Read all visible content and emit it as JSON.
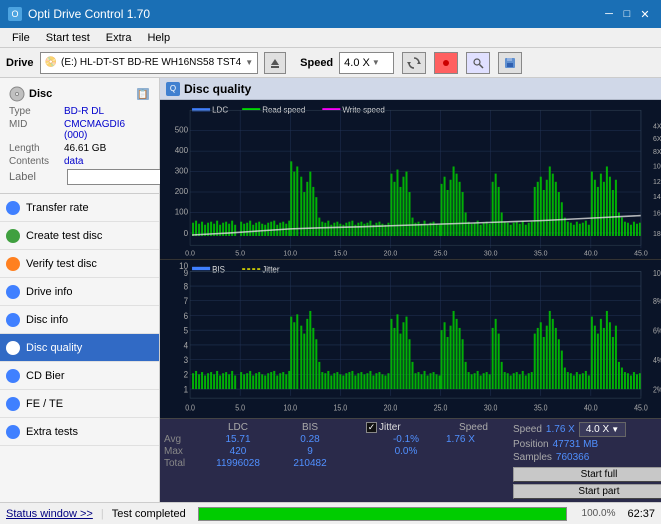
{
  "titleBar": {
    "title": "Opti Drive Control 1.70",
    "minimize": "─",
    "maximize": "□",
    "close": "✕"
  },
  "menuBar": {
    "items": [
      "File",
      "Start test",
      "Extra",
      "Help"
    ]
  },
  "driveBar": {
    "label": "Drive",
    "driveText": "(E:)  HL-DT-ST BD-RE  WH16NS58 TST4",
    "speedLabel": "Speed",
    "speedValue": "4.0 X"
  },
  "disc": {
    "title": "Disc",
    "typeLabel": "Type",
    "typeValue": "BD-R DL",
    "midLabel": "MID",
    "midValue": "CMCMAGDI6 (000)",
    "lengthLabel": "Length",
    "lengthValue": "46.61 GB",
    "contentsLabel": "Contents",
    "contentsValue": "data",
    "labelLabel": "Label"
  },
  "sidebarItems": [
    {
      "id": "transfer-rate",
      "label": "Transfer rate",
      "color": "blue"
    },
    {
      "id": "create-test-disc",
      "label": "Create test disc",
      "color": "green"
    },
    {
      "id": "verify-test-disc",
      "label": "Verify test disc",
      "color": "orange"
    },
    {
      "id": "drive-info",
      "label": "Drive info",
      "color": "blue"
    },
    {
      "id": "disc-info",
      "label": "Disc info",
      "color": "blue"
    },
    {
      "id": "disc-quality",
      "label": "Disc quality",
      "color": "blue",
      "active": true
    },
    {
      "id": "cd-bier",
      "label": "CD Bier",
      "color": "blue"
    },
    {
      "id": "fe-te",
      "label": "FE / TE",
      "color": "blue"
    },
    {
      "id": "extra-tests",
      "label": "Extra tests",
      "color": "blue"
    }
  ],
  "statusBar": {
    "windowBtn": "Status window >>",
    "statusText": "Test completed",
    "progressPct": 100,
    "time": "62:37"
  },
  "content": {
    "title": "Disc quality",
    "legend": {
      "ldc": "LDC",
      "readSpeed": "Read speed",
      "writeSpeed": "Write speed",
      "bis": "BIS",
      "jitter": "Jitter"
    }
  },
  "statsTable": {
    "headers": [
      "LDC",
      "BIS",
      "",
      "Jitter",
      "Speed",
      ""
    ],
    "avg": {
      "ldc": "15.71",
      "bis": "0.28",
      "jitter": "-0.1%",
      "speed": "1.76 X",
      "speedUnit": "4.0 X"
    },
    "max": {
      "ldc": "420",
      "bis": "9",
      "jitter": "0.0%"
    },
    "total": {
      "ldc": "11996028",
      "bis": "210482"
    },
    "position": {
      "label": "Position",
      "value": "47731 MB"
    },
    "samples": {
      "label": "Samples",
      "value": "760366"
    },
    "btnFull": "Start full",
    "btnPart": "Start part"
  }
}
